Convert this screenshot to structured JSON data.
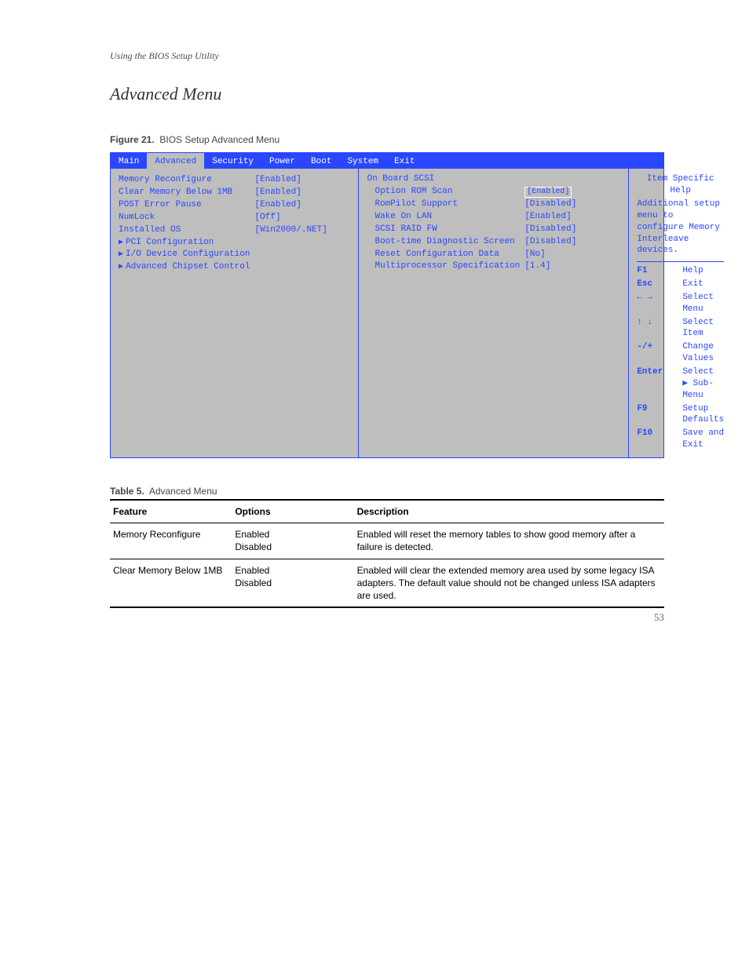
{
  "running_head": "Using the BIOS Setup Utility",
  "section_title": "Advanced Menu",
  "figure_caption_no": "Figure 21.",
  "figure_caption_txt": "BIOS Setup Advanced Menu",
  "bios": {
    "tabs": [
      "Main",
      "Advanced",
      "Security",
      "Power",
      "Boot",
      "System",
      "Exit"
    ],
    "active_tab_index": 1,
    "col1_label": "",
    "rows": [
      {
        "k": "Memory Reconfigure",
        "v": "[Enabled]"
      },
      {
        "k": "Clear Memory Below 1MB",
        "v": "[Enabled]"
      },
      {
        "k": "POST Error Pause",
        "v": "[Enabled]"
      },
      {
        "k": "NumLock",
        "v": "[Off]"
      },
      {
        "k": "Installed OS",
        "v": "[Win2000/.NET]"
      },
      {
        "k": "PCI Configuration",
        "v": "",
        "tri": true
      },
      {
        "k": "I/O Device Configuration",
        "v": "",
        "tri": true
      },
      {
        "k": "Advanced Chipset Control",
        "v": "",
        "tri": true
      }
    ],
    "chip_section_label": "On Board SCSI",
    "chip_rows": [
      {
        "k": "Option ROM Scan",
        "v": "[Enabled]",
        "sel": true
      },
      {
        "k": "RomPilot Support",
        "v": "[Disabled]"
      },
      {
        "k": "Wake On LAN",
        "v": "[Enabled]"
      },
      {
        "k": "SCSI RAID FW",
        "v": "[Disabled]"
      },
      {
        "k": "Boot-time Diagnostic Screen",
        "v": "[Disabled]"
      },
      {
        "k": "Reset Configuration Data",
        "v": "[No]"
      },
      {
        "k": "Multiprocessor Specification",
        "v": "[1.4]"
      }
    ],
    "help_title": "Item Specific Help",
    "help_text": "Additional setup menu to configure Memory Interleave devices.",
    "keys": [
      {
        "glyph": "F1",
        "desc": "Help"
      },
      {
        "glyph": "Esc",
        "desc": "Exit"
      },
      {
        "glyph": "← →",
        "desc": "Select Menu"
      },
      {
        "glyph": "↑ ↓",
        "desc": "Select Item"
      },
      {
        "glyph": "-/+",
        "desc": "Change Values"
      },
      {
        "glyph": "Enter",
        "desc": "Select ▶ Sub-Menu"
      },
      {
        "glyph": "F9",
        "desc": "Setup Defaults"
      },
      {
        "glyph": "F10",
        "desc": "Save and Exit"
      }
    ]
  },
  "table_caption_no": "Table 5.",
  "table_caption_txt": "Advanced Menu",
  "table": {
    "head": [
      "Feature",
      "Options",
      "Description"
    ],
    "rows": [
      {
        "feature": "Memory Reconfigure",
        "options": [
          "Enabled",
          "Disabled"
        ],
        "desc": "Enabled will reset the memory tables to show good memory after a failure is detected."
      },
      {
        "feature": "Clear Memory Below 1MB",
        "options": [
          "Enabled",
          "Disabled"
        ],
        "desc": "Enabled will clear the extended memory area used by some legacy ISA adapters. The default value should not be changed unless ISA adapters are used."
      }
    ]
  },
  "page_number": "53"
}
